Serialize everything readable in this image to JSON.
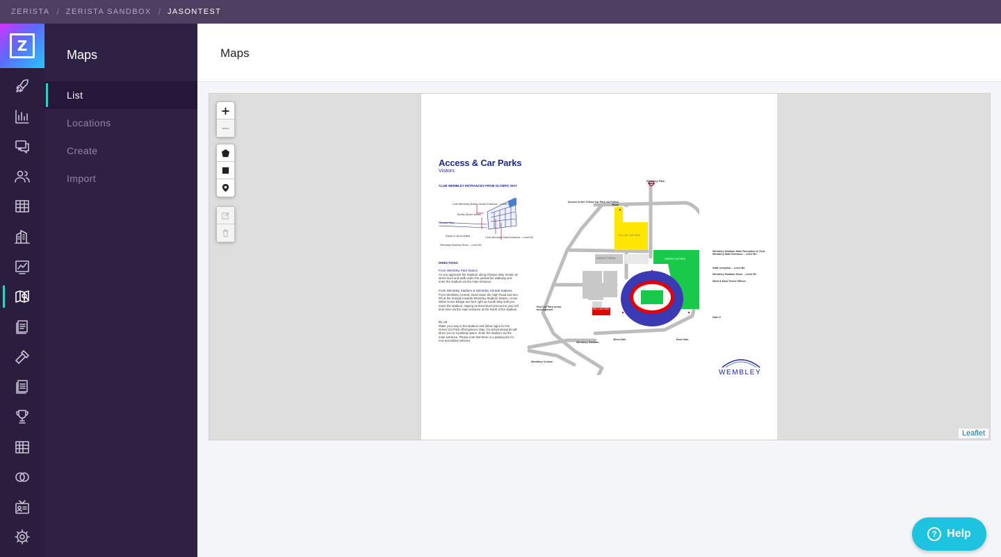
{
  "breadcrumb": [
    "ZERISTA",
    "ZERISTA SANDBOX",
    "JASONTEST"
  ],
  "logo_letter": "Z",
  "rail_items": [
    "rocket-icon",
    "bar-chart-icon",
    "chat-icon",
    "users-icon",
    "grid-icon",
    "building-icon",
    "line-chart-icon",
    "map-icon",
    "document-icon",
    "hammer-icon",
    "report-icon",
    "trophy-icon",
    "table-icon",
    "rings-icon",
    "contacts-icon",
    "gear-icon"
  ],
  "sidebar": {
    "title": "Maps",
    "items": [
      {
        "label": "List"
      },
      {
        "label": "Locations"
      },
      {
        "label": "Create"
      },
      {
        "label": "Import"
      }
    ]
  },
  "main": {
    "title": "Maps"
  },
  "map": {
    "attribution": "Leaflet",
    "zoom_in": "+",
    "zoom_out": "−",
    "document": {
      "title": "Access & Car Parks",
      "subtitle": "Visitors",
      "section_entrances": "CLUB WEMBLEY ENTRANCES FROM OLYMPIC WAY",
      "labels": {
        "bobby_moore_entrance": "Club Wembley Bobby Moore Entrance – Level 1",
        "bobby_moore_statue": "Bobby Moore statue",
        "olympic_way": "Olympic Way",
        "ramp": "Ramp to all turnstiles",
        "club_main_entrance": "Club Wembley Main Entrance – Level B2",
        "station_store": "Wembley Stadium Store – Level B1",
        "wembley_park": "Wembley Park",
        "yellow_access": "Access to the Yellow Car Park via Fulton Road",
        "yellow_car_park": "YELLOW CAR PARK",
        "green_car_park": "GREEN CAR PARK",
        "wembley_arena": "WEMBLEY ARENA",
        "red_car_park": "RED CAR PARK",
        "red_dev": "Red Car Park under development",
        "main_reception": "Wembley Stadium Main Reception & Club Wembley Main Entrance – Level B2",
        "staff_reception": "Staff reception – Level B2",
        "store_b1": "Wembley Stadium Store – Level B1",
        "ticket_office": "West & East Ticket Offices",
        "gate": "Gate 9",
        "west_gate": "West Gate",
        "east_gate": "East Gate",
        "wembley_stadium_stn": "Wembley Stadium",
        "wembley_central": "Wembley Central",
        "brand": "WEMBLEY"
      },
      "directions_heading": "DIRECTIONS",
      "from_park_heading": "From Wembley Park Station",
      "from_park_text": "As you approach the Stadium along Olympic Way remain at street level and walk under the pedestrian walkway and enter the stadium via the main entrance.",
      "from_central_heading": "From Wembley Stadium & Wembley Central Stations",
      "from_central_text": "From Wembley Central, travel down the High Road and turn left at the triangle towards Wembley Stadium Station. Cross White Horse Bridge and turn right up South Way until you reach the stadium, staying at street level proceed to your left and enter via the main entrance at the North of the stadium.",
      "by_car_heading": "By car",
      "by_car_text": "Make your way to the stadium and follow signs for the Green Car Park off Engineers Way. On arrival stewards will direct you to a parking space. Enter the stadium via the main entrance. Please note that there is a parking fee for non-accredited vehicles."
    }
  },
  "help": {
    "label": "Help"
  },
  "colors": {
    "accent": "#2ed3c6",
    "help": "#1ec3df",
    "rail": "#2a1d3e",
    "sidebar": "#2f2143",
    "topbar": "#4e3e62"
  }
}
